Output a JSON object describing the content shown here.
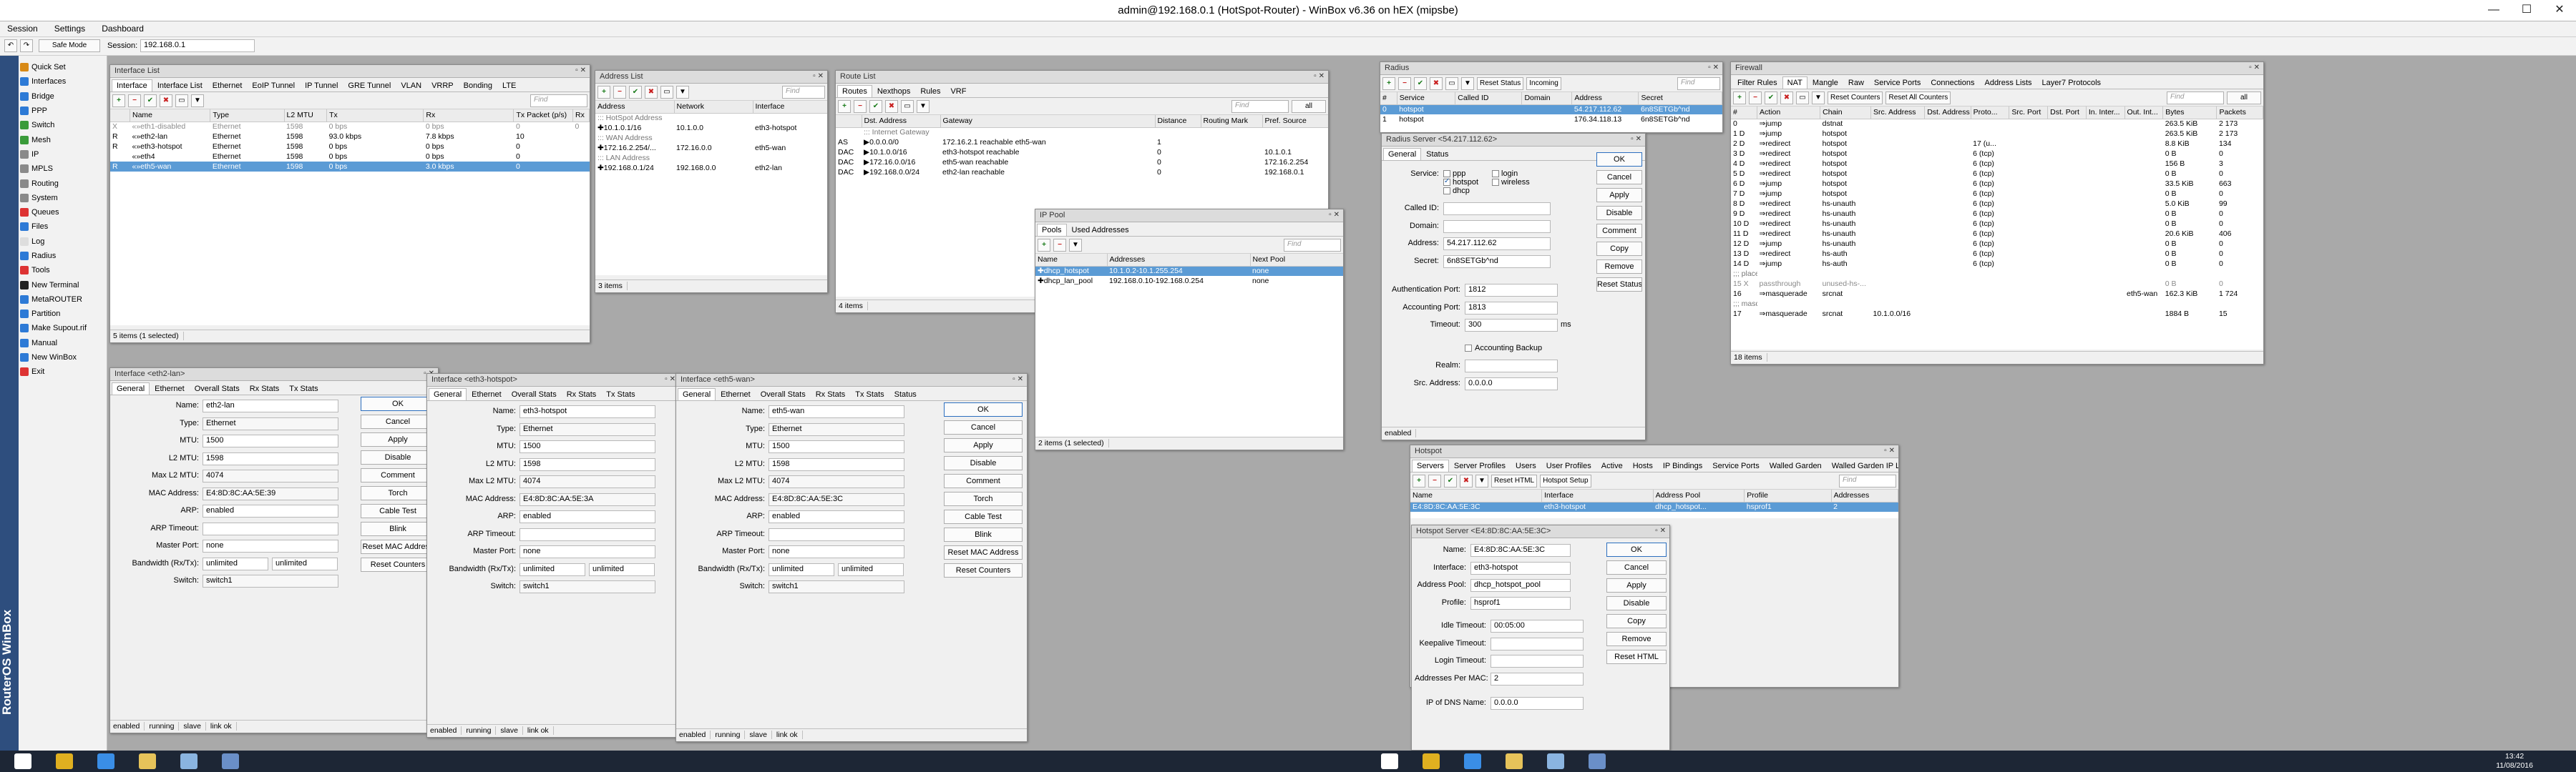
{
  "app": {
    "title": "admin@192.168.0.1 (HotSpot-Router) - WinBox v6.36 on hEX (mipsbe)",
    "minimize": "—",
    "maximize": "☐",
    "close": "✕"
  },
  "menu": [
    "Session",
    "Settings",
    "Dashboard"
  ],
  "toolbar": {
    "undo": "↶",
    "redo": "↷",
    "safe_mode": "Safe Mode",
    "session_label": "Session:",
    "session_value": "192.168.0.1"
  },
  "brand": "RouterOS WinBox",
  "nav": [
    {
      "label": "Quick Set",
      "icon": "quickset-icon",
      "color": "#d88a16"
    },
    {
      "label": "Interfaces",
      "icon": "interfaces-icon",
      "color": "#2d7ad6"
    },
    {
      "label": "Bridge",
      "icon": "bridge-icon",
      "color": "#2d7ad6"
    },
    {
      "label": "PPP",
      "icon": "ppp-icon",
      "color": "#2d7ad6"
    },
    {
      "label": "Switch",
      "icon": "switch-icon",
      "color": "#3a9b3a"
    },
    {
      "label": "Mesh",
      "icon": "mesh-icon",
      "color": "#3a9b3a"
    },
    {
      "label": "IP",
      "icon": "ip-icon",
      "color": "#8a8a8a"
    },
    {
      "label": "MPLS",
      "icon": "mpls-icon",
      "color": "#8a8a8a"
    },
    {
      "label": "Routing",
      "icon": "routing-icon",
      "color": "#8a8a8a"
    },
    {
      "label": "System",
      "icon": "system-icon",
      "color": "#8a8a8a"
    },
    {
      "label": "Queues",
      "icon": "queues-icon",
      "color": "#d33"
    },
    {
      "label": "Files",
      "icon": "files-icon",
      "color": "#2d7ad6"
    },
    {
      "label": "Log",
      "icon": "log-icon",
      "color": "#ddd"
    },
    {
      "label": "Radius",
      "icon": "radius-icon",
      "color": "#2d7ad6"
    },
    {
      "label": "Tools",
      "icon": "tools-icon",
      "color": "#d33"
    },
    {
      "label": "New Terminal",
      "icon": "terminal-icon",
      "color": "#222"
    },
    {
      "label": "MetaROUTER",
      "icon": "metarouter-icon",
      "color": "#2d7ad6"
    },
    {
      "label": "Partition",
      "icon": "partition-icon",
      "color": "#2d7ad6"
    },
    {
      "label": "Make Supout.rif",
      "icon": "supout-icon",
      "color": "#2d7ad6"
    },
    {
      "label": "Manual",
      "icon": "manual-icon",
      "color": "#2d7ad6"
    },
    {
      "label": "New WinBox",
      "icon": "winbox-icon",
      "color": "#2d7ad6"
    },
    {
      "label": "Exit",
      "icon": "exit-icon",
      "color": "#d33"
    }
  ],
  "interface_list": {
    "title": "Interface List",
    "tabs": [
      "Interface",
      "Interface List",
      "Ethernet",
      "EoIP Tunnel",
      "IP Tunnel",
      "GRE Tunnel",
      "VLAN",
      "VRRP",
      "Bonding",
      "LTE"
    ],
    "find": "Find",
    "columns": [
      "",
      "Name",
      "Type",
      "L2 MTU",
      "Tx",
      "Rx",
      "Tx Packet (p/s)",
      "Rx"
    ],
    "rows": [
      [
        "X",
        "«»eth1-disabled",
        "Ethernet",
        "1598",
        "0 bps",
        "0 bps",
        "0",
        "0"
      ],
      [
        "R",
        "«»eth2-lan",
        "Ethernet",
        "1598",
        "93.0 kbps",
        "7.8 kbps",
        "10",
        ""
      ],
      [
        "R",
        "«»eth3-hotspot",
        "Ethernet",
        "1598",
        "0 bps",
        "0 bps",
        "0",
        ""
      ],
      [
        "",
        "«»eth4",
        "Ethernet",
        "1598",
        "0 bps",
        "0 bps",
        "0",
        ""
      ],
      [
        "R",
        "«»eth5-wan",
        "Ethernet",
        "1598",
        "0 bps",
        "3.0 kbps",
        "0",
        ""
      ]
    ],
    "status": "5 items (1 selected)"
  },
  "address_list": {
    "title": "Address List",
    "find": "Find",
    "columns": [
      "Address",
      "Network",
      "Interface"
    ],
    "rows": [
      [
        "::: HotSpot Address",
        "",
        ""
      ],
      [
        "✚10.1.0.1/16",
        "10.1.0.0",
        "eth3-hotspot"
      ],
      [
        "::: WAN Address",
        "",
        ""
      ],
      [
        "✚172.16.2.254/...",
        "172.16.0.0",
        "eth5-wan"
      ],
      [
        "::: LAN Address",
        "",
        ""
      ],
      [
        "✚192.168.0.1/24",
        "192.168.0.0",
        "eth2-lan"
      ]
    ],
    "status": "3 items"
  },
  "route_list": {
    "title": "Route List",
    "tabs": [
      "Routes",
      "Nexthops",
      "Rules",
      "VRF"
    ],
    "find": "Find",
    "filter": "all",
    "columns": [
      "",
      "Dst. Address",
      "Gateway",
      "Distance",
      "Routing Mark",
      "Pref. Source"
    ],
    "rows": [
      [
        "",
        "::: Internet Gateway",
        "",
        "",
        "",
        ""
      ],
      [
        "AS",
        "▶0.0.0.0/0",
        "172.16.2.1 reachable eth5-wan",
        "1",
        "",
        ""
      ],
      [
        "DAC",
        "▶10.1.0.0/16",
        "eth3-hotspot reachable",
        "0",
        "",
        "10.1.0.1"
      ],
      [
        "DAC",
        "▶172.16.0.0/16",
        "eth5-wan reachable",
        "0",
        "",
        "172.16.2.254"
      ],
      [
        "DAC",
        "▶192.168.0.0/24",
        "eth2-lan reachable",
        "0",
        "",
        "192.168.0.1"
      ]
    ],
    "status": "4 items"
  },
  "ip_pool": {
    "title": "IP Pool",
    "tabs": [
      "Pools",
      "Used Addresses"
    ],
    "find": "Find",
    "columns": [
      "Name",
      "Addresses",
      "Next Pool"
    ],
    "rows": [
      [
        "✚dhcp_hotspot",
        "10.1.0.2-10.1.255.254",
        "none"
      ],
      [
        "✚dhcp_lan_pool",
        "192.168.0.10-192.168.0.254",
        "none"
      ]
    ],
    "status": "2 items (1 selected)"
  },
  "radius": {
    "title": "Radius",
    "reset_status": "Reset Status",
    "incoming": "Incoming",
    "find": "Find",
    "columns": [
      "#",
      "Service",
      "Called ID",
      "Domain",
      "Address",
      "Secret"
    ],
    "rows": [
      [
        "0",
        "hotspot",
        "",
        "",
        "54.217.112.62",
        "6n8SETGb^nd"
      ],
      [
        "1",
        "hotspot",
        "",
        "",
        "176.34.118.13",
        "6n8SETGb^nd"
      ]
    ]
  },
  "radius_server": {
    "title": "Radius Server <54.217.112.62>",
    "tabs": [
      "General",
      "Status"
    ],
    "service_label": "Service:",
    "services": [
      {
        "label": "ppp",
        "checked": false
      },
      {
        "label": "login",
        "checked": false
      },
      {
        "label": "hotspot",
        "checked": true
      },
      {
        "label": "wireless",
        "checked": false
      },
      {
        "label": "dhcp",
        "checked": false
      }
    ],
    "called_id_label": "Called ID:",
    "called_id": "",
    "domain_label": "Domain:",
    "domain": "",
    "address_label": "Address:",
    "address": "54.217.112.62",
    "secret_label": "Secret:",
    "secret": "6n8SETGb^nd",
    "auth_port_label": "Authentication Port:",
    "auth_port": "1812",
    "acct_port_label": "Accounting Port:",
    "acct_port": "1813",
    "timeout_label": "Timeout:",
    "timeout": "300",
    "timeout_unit": "ms",
    "acct_backup": "Accounting Backup",
    "realm_label": "Realm:",
    "realm": "",
    "src_label": "Src. Address:",
    "src": "0.0.0.0",
    "buttons": [
      "OK",
      "Cancel",
      "Apply",
      "Disable",
      "Comment",
      "Copy",
      "Remove",
      "Reset Status"
    ],
    "status": "enabled"
  },
  "firewall": {
    "title": "Firewall",
    "tabs": [
      "Filter Rules",
      "NAT",
      "Mangle",
      "Raw",
      "Service Ports",
      "Connections",
      "Address Lists",
      "Layer7 Protocols"
    ],
    "reset_counters": "Reset Counters",
    "reset_all": "Reset All Counters",
    "find": "Find",
    "filter": "all",
    "columns": [
      "#",
      "Action",
      "Chain",
      "Src. Address",
      "Dst. Address",
      "Proto...",
      "Src. Port",
      "Dst. Port",
      "In. Inter...",
      "Out. Int...",
      "Bytes",
      "Packets"
    ],
    "rows": [
      [
        "0",
        "⇒jump",
        "dstnat",
        "",
        "",
        "",
        "",
        "",
        "",
        "",
        "263.5 KiB",
        "2 173"
      ],
      [
        "1 D",
        "⇒jump",
        "hotspot",
        "",
        "",
        "",
        "",
        "",
        "",
        "",
        "263.5 KiB",
        "2 173"
      ],
      [
        "2 D",
        "⇒redirect",
        "hotspot",
        "",
        "",
        "17 (u...",
        "",
        "",
        "",
        "",
        "8.8 KiB",
        "134"
      ],
      [
        "3 D",
        "⇒redirect",
        "hotspot",
        "",
        "",
        "6 (tcp)",
        "",
        "",
        "",
        "",
        "0 B",
        "0"
      ],
      [
        "4 D",
        "⇒redirect",
        "hotspot",
        "",
        "",
        "6 (tcp)",
        "",
        "",
        "",
        "",
        "156 B",
        "3"
      ],
      [
        "5 D",
        "⇒redirect",
        "hotspot",
        "",
        "",
        "6 (tcp)",
        "",
        "",
        "",
        "",
        "0 B",
        "0"
      ],
      [
        "6 D",
        "⇒jump",
        "hotspot",
        "",
        "",
        "6 (tcp)",
        "",
        "",
        "",
        "",
        "33.5 KiB",
        "663"
      ],
      [
        "7 D",
        "⇒jump",
        "hotspot",
        "",
        "",
        "6 (tcp)",
        "",
        "",
        "",
        "",
        "0 B",
        "0"
      ],
      [
        "8 D",
        "⇒redirect",
        "hs-unauth",
        "",
        "",
        "6 (tcp)",
        "",
        "",
        "",
        "",
        "5.0 KiB",
        "99"
      ],
      [
        "9 D",
        "⇒redirect",
        "hs-unauth",
        "",
        "",
        "6 (tcp)",
        "",
        "",
        "",
        "",
        "0 B",
        "0"
      ],
      [
        "10 D",
        "⇒redirect",
        "hs-unauth",
        "",
        "",
        "6 (tcp)",
        "",
        "",
        "",
        "",
        "0 B",
        "0"
      ],
      [
        "11 D",
        "⇒redirect",
        "hs-unauth",
        "",
        "",
        "6 (tcp)",
        "",
        "",
        "",
        "",
        "20.6 KiB",
        "406"
      ],
      [
        "12 D",
        "⇒jump",
        "hs-unauth",
        "",
        "",
        "6 (tcp)",
        "",
        "",
        "",
        "",
        "0 B",
        "0"
      ],
      [
        "13 D",
        "⇒redirect",
        "hs-auth",
        "",
        "",
        "6 (tcp)",
        "",
        "",
        "",
        "",
        "0 B",
        "0"
      ],
      [
        "14 D",
        "⇒jump",
        "hs-auth",
        "",
        "",
        "6 (tcp)",
        "",
        "",
        "",
        "",
        "0 B",
        "0"
      ],
      [
        ";;; place hotspot rules here",
        "",
        "",
        "",
        "",
        "",
        "",
        "",
        "",
        "",
        "",
        ""
      ],
      [
        "15 X",
        "passthrough",
        "unused-hs-...",
        "",
        "",
        "",
        "",
        "",
        "",
        "",
        "0 B",
        "0"
      ],
      [
        "16",
        "⇒masquerade",
        "srcnat",
        "",
        "",
        "",
        "",
        "",
        "",
        "eth5-wan",
        "162.3 KiB",
        "1 724"
      ],
      [
        ";;; masquerade hotspot network",
        "",
        "",
        "",
        "",
        "",
        "",
        "",
        "",
        "",
        "",
        ""
      ],
      [
        "17",
        "⇒masquerade",
        "srcnat",
        "10.1.0.0/16",
        "",
        "",
        "",
        "",
        "",
        "",
        "1884 B",
        "15"
      ]
    ],
    "status": "18 items"
  },
  "hotspot": {
    "title": "Hotspot",
    "tabs": [
      "Servers",
      "Server Profiles",
      "Users",
      "User Profiles",
      "Active",
      "Hosts",
      "IP Bindings",
      "Service Ports",
      "Walled Garden",
      "Walled Garden IP List"
    ],
    "reset_html": "Reset HTML",
    "setup": "Hotspot Setup",
    "find": "Find",
    "columns": [
      "Name",
      "Interface",
      "Address Pool",
      "Profile",
      "Addresses"
    ],
    "rows": [
      [
        "E4:8D:8C:AA:5E:3C",
        "eth3-hotspot",
        "dhcp_hotspot...",
        "hsprof1",
        "2"
      ]
    ]
  },
  "hotspot_server": {
    "title": "Hotspot Server <E4:8D:8C:AA:5E:3C>",
    "name_label": "Name:",
    "name": "E4:8D:8C:AA:5E:3C",
    "interface_label": "Interface:",
    "interface": "eth3-hotspot",
    "pool_label": "Address Pool:",
    "pool": "dhcp_hotspot_pool",
    "profile_label": "Profile:",
    "profile": "hsprof1",
    "idle_label": "Idle Timeout:",
    "idle": "00:05:00",
    "keepalive_label": "Keepalive Timeout:",
    "keepalive": "",
    "login_label": "Login Timeout:",
    "login": "",
    "apm_label": "Addresses Per MAC:",
    "apm": "2",
    "dns_label": "IP of DNS Name:",
    "dns": "0.0.0.0",
    "buttons": [
      "OK",
      "Cancel",
      "Apply",
      "Disable",
      "Copy",
      "Remove",
      "Reset HTML"
    ]
  },
  "iface_eth2": {
    "title": "Interface <eth2-lan>",
    "tabs": [
      "General",
      "Ethernet",
      "Overall Stats",
      "Rx Stats",
      "Tx Stats"
    ],
    "fields": [
      {
        "label": "Name:",
        "value": "eth2-lan"
      },
      {
        "label": "Type:",
        "value": "Ethernet"
      },
      {
        "label": "MTU:",
        "value": "1500"
      },
      {
        "label": "L2 MTU:",
        "value": "1598"
      },
      {
        "label": "Max L2 MTU:",
        "value": "4074"
      },
      {
        "label": "MAC Address:",
        "value": "E4:8D:8C:AA:5E:39"
      },
      {
        "label": "ARP:",
        "value": "enabled"
      },
      {
        "label": "ARP Timeout:",
        "value": ""
      },
      {
        "label": "Master Port:",
        "value": "none"
      },
      {
        "label": "Bandwidth (Rx/Tx):",
        "value": "unlimited",
        "value2": "unlimited"
      },
      {
        "label": "Switch:",
        "value": "switch1"
      }
    ],
    "buttons": [
      "OK",
      "Cancel",
      "Apply",
      "Disable",
      "Comment",
      "Torch",
      "Cable Test",
      "Blink",
      "Reset MAC Address",
      "Reset Counters"
    ],
    "status": [
      "enabled",
      "running",
      "slave",
      "link ok"
    ]
  },
  "iface_eth3": {
    "title": "Interface <eth3-hotspot>",
    "tabs": [
      "General",
      "Ethernet",
      "Overall Stats",
      "Rx Stats",
      "Tx Stats"
    ],
    "fields": [
      {
        "label": "Name:",
        "value": "eth3-hotspot"
      },
      {
        "label": "Type:",
        "value": "Ethernet"
      },
      {
        "label": "MTU:",
        "value": "1500"
      },
      {
        "label": "L2 MTU:",
        "value": "1598"
      },
      {
        "label": "Max L2 MTU:",
        "value": "4074"
      },
      {
        "label": "MAC Address:",
        "value": "E4:8D:8C:AA:5E:3A"
      },
      {
        "label": "ARP:",
        "value": "enabled"
      },
      {
        "label": "ARP Timeout:",
        "value": ""
      },
      {
        "label": "Master Port:",
        "value": "none"
      },
      {
        "label": "Bandwidth (Rx/Tx):",
        "value": "unlimited",
        "value2": "unlimited"
      },
      {
        "label": "Switch:",
        "value": "switch1"
      }
    ],
    "status": [
      "enabled",
      "running",
      "slave",
      "link ok"
    ]
  },
  "iface_eth5": {
    "title": "Interface <eth5-wan>",
    "tabs": [
      "General",
      "Ethernet",
      "Overall Stats",
      "Rx Stats",
      "Tx Stats",
      "Status"
    ],
    "fields": [
      {
        "label": "Name:",
        "value": "eth5-wan"
      },
      {
        "label": "Type:",
        "value": "Ethernet"
      },
      {
        "label": "MTU:",
        "value": "1500"
      },
      {
        "label": "L2 MTU:",
        "value": "1598"
      },
      {
        "label": "Max L2 MTU:",
        "value": "4074"
      },
      {
        "label": "MAC Address:",
        "value": "E4:8D:8C:AA:5E:3C"
      },
      {
        "label": "ARP:",
        "value": "enabled"
      },
      {
        "label": "ARP Timeout:",
        "value": ""
      },
      {
        "label": "Master Port:",
        "value": "none"
      },
      {
        "label": "Bandwidth (Rx/Tx):",
        "value": "unlimited",
        "value2": "unlimited"
      },
      {
        "label": "Switch:",
        "value": "switch1"
      }
    ],
    "buttons": [
      "OK",
      "Cancel",
      "Apply",
      "Disable",
      "Comment",
      "Torch",
      "Cable Test",
      "Blink",
      "Reset MAC Address",
      "Reset Counters"
    ],
    "status": [
      "enabled",
      "running",
      "slave",
      "link ok"
    ]
  },
  "taskbar": {
    "time": "13:42",
    "date": "11/08/2016",
    "icons": [
      {
        "name": "start-icon",
        "color": "#ffffff"
      },
      {
        "name": "chrome-icon",
        "color": "#e0b020"
      },
      {
        "name": "ie-icon",
        "color": "#3a8ee6"
      },
      {
        "name": "explorer-icon",
        "color": "#e6c35a"
      },
      {
        "name": "vmware-icon",
        "color": "#8ab4e0"
      },
      {
        "name": "winbox-icon",
        "color": "#6a8fc8"
      }
    ],
    "icons2": [
      {
        "name": "windows-icon",
        "color": "#ffffff"
      },
      {
        "name": "chrome-icon",
        "color": "#e0b020"
      },
      {
        "name": "ie-icon",
        "color": "#3a8ee6"
      },
      {
        "name": "explorer-icon",
        "color": "#e6c35a"
      },
      {
        "name": "vmware-icon",
        "color": "#8ab4e0"
      },
      {
        "name": "winbox-icon",
        "color": "#6a8fc8"
      }
    ]
  }
}
